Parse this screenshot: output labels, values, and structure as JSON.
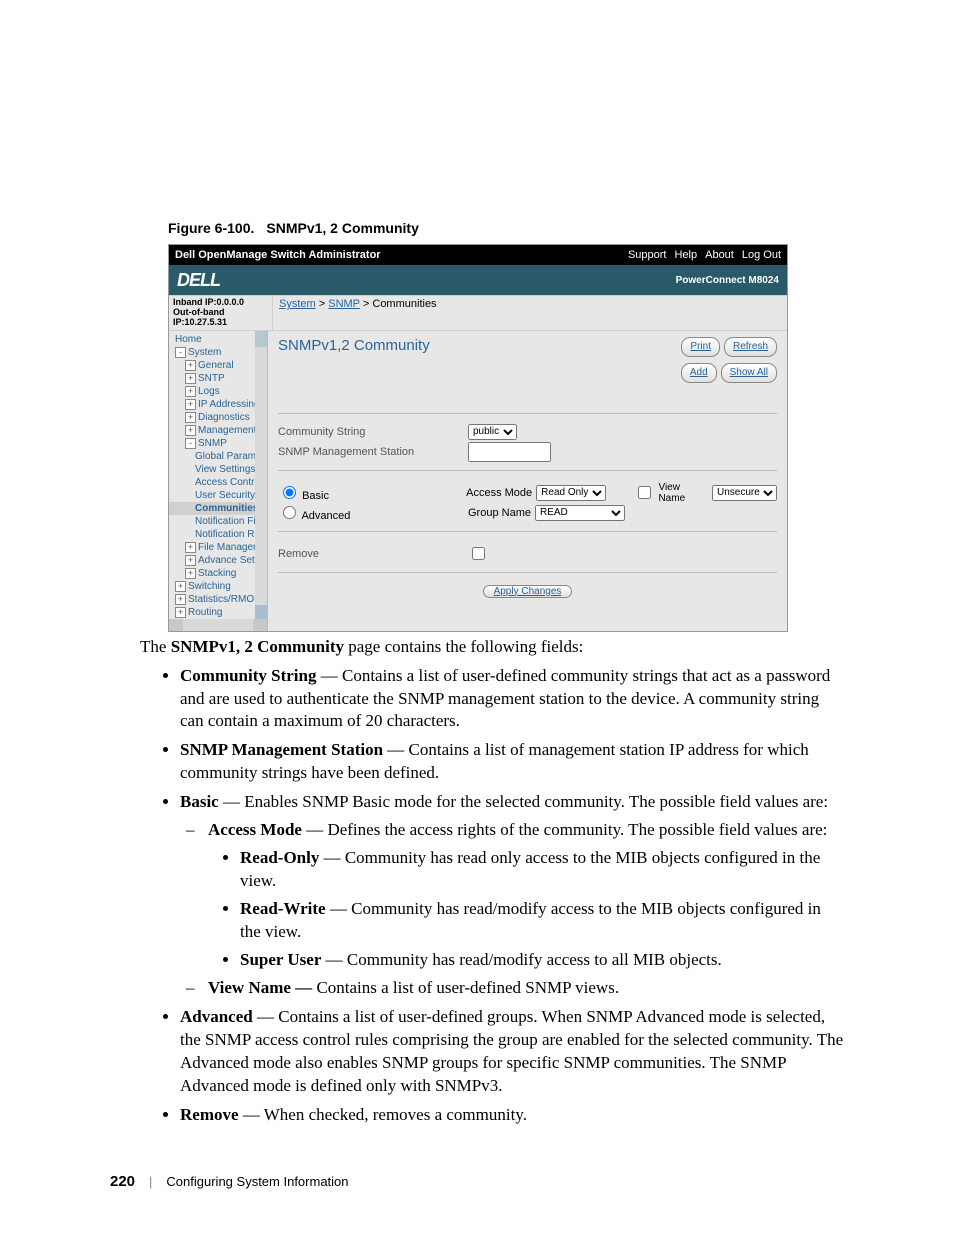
{
  "figure_caption": {
    "label": "Figure 6-100.",
    "title": "SNMPv1, 2 Community"
  },
  "screenshot": {
    "topbar": {
      "title": "Dell OpenManage Switch Administrator",
      "links": [
        "Support",
        "Help",
        "About",
        "Log Out"
      ]
    },
    "logobar": {
      "logo": "DELL",
      "model": "PowerConnect M8024"
    },
    "ipbar": {
      "inband": "Inband IP:0.0.0.0",
      "outband": "Out-of-band IP:10.27.5.31",
      "crumbs": [
        "System",
        "SNMP",
        "Communities"
      ]
    },
    "tree": {
      "items": [
        {
          "label": "Home",
          "cls": ""
        },
        {
          "label": "System",
          "cls": "",
          "box": "-"
        },
        {
          "label": "General",
          "cls": "l2",
          "box": "+"
        },
        {
          "label": "SNTP",
          "cls": "l2",
          "box": "+"
        },
        {
          "label": "Logs",
          "cls": "l2",
          "box": "+"
        },
        {
          "label": "IP Addressing",
          "cls": "l2",
          "box": "+"
        },
        {
          "label": "Diagnostics",
          "cls": "l2",
          "box": "+"
        },
        {
          "label": "Management Secur",
          "cls": "l2",
          "box": "+"
        },
        {
          "label": "SNMP",
          "cls": "l2",
          "box": "-"
        },
        {
          "label": "Global Paramete",
          "cls": "l3"
        },
        {
          "label": "View Settings",
          "cls": "l3"
        },
        {
          "label": "Access Control (",
          "cls": "l3"
        },
        {
          "label": "User Security M",
          "cls": "l3"
        },
        {
          "label": "Communities",
          "cls": "l3 sel"
        },
        {
          "label": "Notification Filter",
          "cls": "l3"
        },
        {
          "label": "Notification Recip",
          "cls": "l3"
        },
        {
          "label": "File Management",
          "cls": "l2",
          "box": "+"
        },
        {
          "label": "Advance Settings",
          "cls": "l2",
          "box": "+"
        },
        {
          "label": "Stacking",
          "cls": "l2",
          "box": "+"
        },
        {
          "label": "Switching",
          "cls": "",
          "box": "+"
        },
        {
          "label": "Statistics/RMON",
          "cls": "",
          "box": "+"
        },
        {
          "label": "Routing",
          "cls": "",
          "box": "+"
        }
      ]
    },
    "panel": {
      "title": "SNMPv1,2 Community",
      "buttons": {
        "print": "Print",
        "refresh": "Refresh",
        "add": "Add",
        "showall": "Show All"
      },
      "community_string_label": "Community String",
      "community_string_value": "public",
      "mgmt_station_label": "SNMP Management Station",
      "mgmt_station_value": "",
      "basic_label": "Basic",
      "access_mode_label": "Access Mode",
      "access_mode_value": "Read Only",
      "view_name_label": "View Name",
      "view_name_value": "Unsecure",
      "advanced_label": "Advanced",
      "group_name_label": "Group Name",
      "group_name_value": "READ",
      "remove_label": "Remove",
      "apply_label": "Apply Changes"
    }
  },
  "body": {
    "lead_pre": "The ",
    "lead_bold": "SNMPv1, 2 Community",
    "lead_post": " page contains the following fields:",
    "i1": {
      "b": "Community String",
      "t": " — Contains a list of user-defined community strings that act as a password and are used to authenticate the SNMP management station to the device. A community string can contain a maximum of 20 characters."
    },
    "i2": {
      "b": "SNMP Management Station",
      "t": " — Contains a list of management station IP address for which community strings have been defined."
    },
    "i3": {
      "b": "Basic",
      "t": " — Enables SNMP Basic mode for the selected community. The possible field values are:"
    },
    "i3a": {
      "b": "Access Mode",
      "t": " — Defines the access rights of the community. The possible field values are:"
    },
    "i3a1": {
      "b": "Read-Only",
      "t": " — Community has read only access to the MIB objects configured in the view."
    },
    "i3a2": {
      "b": "Read-Write",
      "t": " — Community has read/modify access to the MIB objects configured in the view."
    },
    "i3a3": {
      "b": "Super User",
      "t": " — Community has read/modify access to all MIB objects."
    },
    "i3b": {
      "b": "View Name —",
      "t": " Contains a list of user-defined SNMP views."
    },
    "i4": {
      "b": "Advanced",
      "t": " — Contains a list of user-defined groups. When SNMP Advanced mode is selected, the SNMP access control rules comprising the group are enabled for the selected community. The Advanced mode also enables SNMP groups for specific SNMP communities. The SNMP Advanced mode is defined only with SNMPv3."
    },
    "i5": {
      "b": "Remove",
      "t": " — When checked, removes a community."
    }
  },
  "footer": {
    "page": "220",
    "section": "Configuring System Information"
  }
}
